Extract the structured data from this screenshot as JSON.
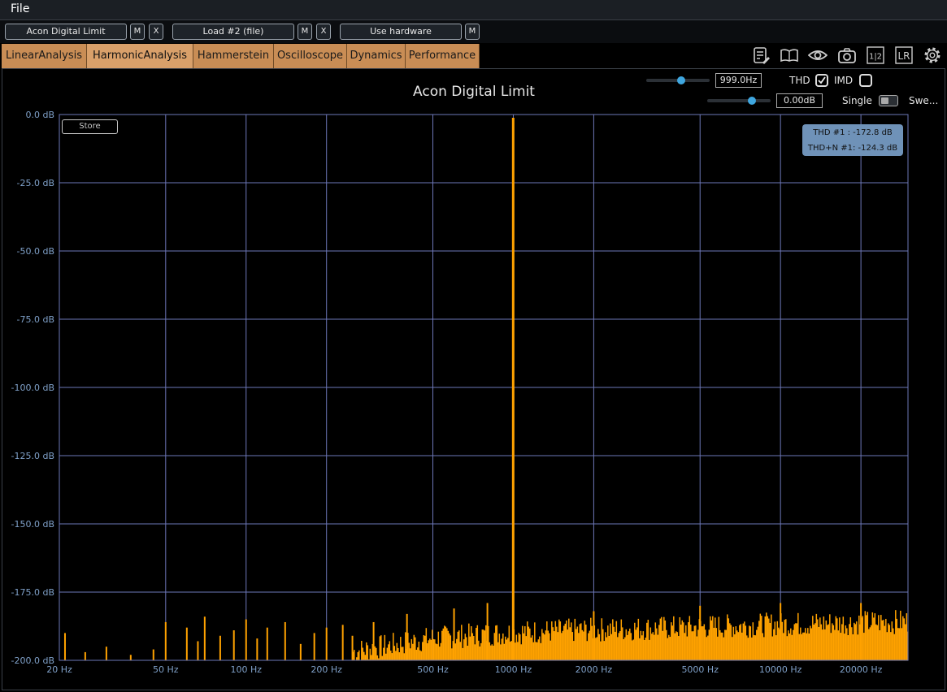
{
  "menu": {
    "file": "File"
  },
  "toolbar": {
    "source1": "Acon Digital Limit",
    "source2": "Load #2 (file)",
    "source3": "Use hardware",
    "m_label": "M",
    "x_label": "X"
  },
  "tabs": [
    {
      "label": "LinearAnalysis"
    },
    {
      "label": "HarmonicAnalysis",
      "active": true
    },
    {
      "label": "Hammerstein"
    },
    {
      "label": "Oscilloscope"
    },
    {
      "label": "Dynamics"
    },
    {
      "label": "Performance"
    }
  ],
  "icons": [
    "notes-icon",
    "book-icon",
    "eye-icon",
    "camera-icon",
    "channel-1-2-icon",
    "lr-icon",
    "gear-icon"
  ],
  "icon_text": {
    "channel": "1|2",
    "lr": "LR"
  },
  "controls": {
    "frequency": "999.0Hz",
    "frequency_slider": 0.55,
    "level": "0.00dB",
    "level_slider": 0.7,
    "thd_label": "THD",
    "thd_checked": true,
    "imd_label": "IMD",
    "imd_checked": false,
    "mode_single": "Single",
    "mode_sweep": "Swe..."
  },
  "store_button": "Store",
  "readout": {
    "thd": "THD #1 : -172.8 dB",
    "thdn": "THD+N #1: -124.3 dB"
  },
  "colors": {
    "accent": "#ffa200",
    "grid": "#6d77b8",
    "tab": "#c98d55",
    "knob": "#3fa7e0"
  },
  "chart_data": {
    "type": "bar",
    "title": "Acon Digital Limit",
    "xlabel": "",
    "ylabel": "",
    "x_scale": "log",
    "xlim": [
      20,
      30000
    ],
    "ylim": [
      -200,
      0
    ],
    "y_ticks": [
      "0.0 dB",
      "-25.0 dB",
      "-50.0 dB",
      "-75.0 dB",
      "-100.0 dB",
      "-125.0 dB",
      "-150.0 dB",
      "-175.0 dB",
      "-200.0 dB"
    ],
    "y_tick_values": [
      0,
      -25,
      -50,
      -75,
      -100,
      -125,
      -150,
      -175,
      -200
    ],
    "x_ticks": [
      "20 Hz",
      "50 Hz",
      "100 Hz",
      "200 Hz",
      "500 Hz",
      "1000 Hz",
      "2000 Hz",
      "5000 Hz",
      "10000 Hz",
      "20000 Hz"
    ],
    "x_tick_values": [
      20,
      50,
      100,
      200,
      500,
      1000,
      2000,
      5000,
      10000,
      20000
    ],
    "grid": true,
    "fundamental": {
      "x": 999,
      "y": 0
    },
    "peaks": [
      {
        "x": 21,
        "y": -190
      },
      {
        "x": 25,
        "y": -197
      },
      {
        "x": 30,
        "y": -195
      },
      {
        "x": 37,
        "y": -198
      },
      {
        "x": 45,
        "y": -196
      },
      {
        "x": 50,
        "y": -186
      },
      {
        "x": 60,
        "y": -188
      },
      {
        "x": 66,
        "y": -193
      },
      {
        "x": 70,
        "y": -184
      },
      {
        "x": 80,
        "y": -191
      },
      {
        "x": 90,
        "y": -189
      },
      {
        "x": 100,
        "y": -185
      },
      {
        "x": 110,
        "y": -192
      },
      {
        "x": 120,
        "y": -188
      },
      {
        "x": 140,
        "y": -186
      },
      {
        "x": 160,
        "y": -194
      },
      {
        "x": 180,
        "y": -190
      },
      {
        "x": 200,
        "y": -188
      },
      {
        "x": 230,
        "y": -187
      },
      {
        "x": 250,
        "y": -191
      },
      {
        "x": 300,
        "y": -186
      },
      {
        "x": 400,
        "y": -183
      },
      {
        "x": 600,
        "y": -181
      },
      {
        "x": 800,
        "y": -179
      },
      {
        "x": 2000,
        "y": -182
      },
      {
        "x": 5000,
        "y": -180
      },
      {
        "x": 10000,
        "y": -179
      },
      {
        "x": 20000,
        "y": -179
      }
    ],
    "noise_floor": [
      {
        "x": 250,
        "y": -195
      },
      {
        "x": 500,
        "y": -190
      },
      {
        "x": 1000,
        "y": -188
      },
      {
        "x": 2000,
        "y": -187
      },
      {
        "x": 5000,
        "y": -186
      },
      {
        "x": 10000,
        "y": -185
      },
      {
        "x": 30000,
        "y": -184
      }
    ]
  }
}
